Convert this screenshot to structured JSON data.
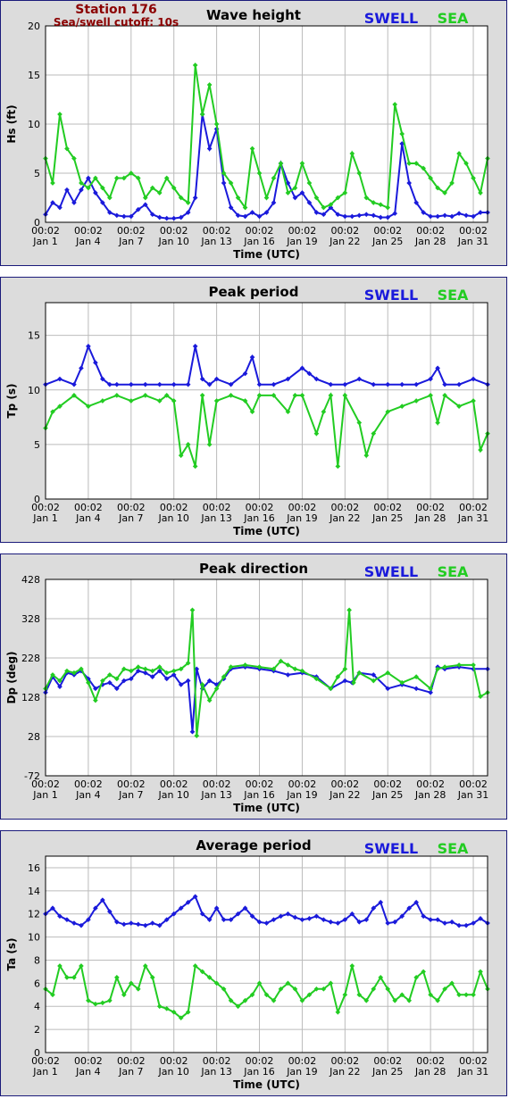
{
  "header": {
    "station": "Station 176",
    "cutoff": "Sea/swell cutoff: 10s"
  },
  "legend": {
    "swell": "SWELL",
    "sea": "SEA",
    "swell_color": "#1a1adb",
    "sea_color": "#22cc22"
  },
  "time_axis": {
    "title": "Time (UTC)",
    "ticks": [
      {
        "top": "00:02",
        "bottom": "Jan 1"
      },
      {
        "top": "00:02",
        "bottom": "Jan 4"
      },
      {
        "top": "00:02",
        "bottom": "Jan 7"
      },
      {
        "top": "00:02",
        "bottom": "Jan 10"
      },
      {
        "top": "00:02",
        "bottom": "Jan 13"
      },
      {
        "top": "00:02",
        "bottom": "Jan 16"
      },
      {
        "top": "00:02",
        "bottom": "Jan 19"
      },
      {
        "top": "00:02",
        "bottom": "Jan 22"
      },
      {
        "top": "00:02",
        "bottom": "Jan 25"
      },
      {
        "top": "00:02",
        "bottom": "Jan 28"
      },
      {
        "top": "00:02",
        "bottom": "Jan 31"
      }
    ]
  },
  "chart_data": [
    {
      "type": "line",
      "title": "Wave height",
      "ylabel": "Hs (ft)",
      "ylim": [
        0,
        20
      ],
      "yticks": [
        0,
        5,
        10,
        15,
        20
      ],
      "xlim": [
        1,
        32
      ],
      "series": [
        {
          "name": "SWELL",
          "color": "#1a1adb",
          "x": [
            1,
            1.5,
            2,
            2.5,
            3,
            3.5,
            4,
            4.5,
            5,
            5.5,
            6,
            6.5,
            7,
            7.5,
            8,
            8.5,
            9,
            9.5,
            10,
            10.5,
            11,
            11.5,
            12,
            12.5,
            13,
            13.5,
            14,
            14.5,
            15,
            15.5,
            16,
            16.5,
            17,
            17.5,
            18,
            18.5,
            19,
            19.5,
            20,
            20.5,
            21,
            21.5,
            22,
            22.5,
            23,
            23.5,
            24,
            24.5,
            25,
            25.5,
            26,
            26.5,
            27,
            27.5,
            28,
            28.5,
            29,
            29.5,
            30,
            30.5,
            31,
            31.5,
            32
          ],
          "y": [
            0.8,
            2.0,
            1.5,
            3.3,
            2.0,
            3.3,
            4.5,
            3.0,
            2.0,
            1.0,
            0.7,
            0.6,
            0.6,
            1.3,
            1.8,
            0.8,
            0.5,
            0.4,
            0.4,
            0.5,
            1.0,
            2.5,
            11.0,
            7.5,
            9.5,
            4.0,
            1.5,
            0.7,
            0.6,
            1.0,
            0.6,
            1.0,
            2.0,
            6.0,
            4.0,
            2.5,
            3.0,
            2.0,
            1.0,
            0.8,
            1.5,
            0.8,
            0.6,
            0.6,
            0.7,
            0.8,
            0.7,
            0.5,
            0.5,
            0.9,
            8.0,
            4.0,
            2.0,
            1.0,
            0.6,
            0.6,
            0.7,
            0.6,
            0.9,
            0.7,
            0.6,
            1.0,
            1.0
          ]
        },
        {
          "name": "SEA",
          "color": "#22cc22",
          "x": [
            1,
            1.5,
            2,
            2.5,
            3,
            3.5,
            4,
            4.5,
            5,
            5.5,
            6,
            6.5,
            7,
            7.5,
            8,
            8.5,
            9,
            9.5,
            10,
            10.5,
            11,
            11.5,
            12,
            12.5,
            13,
            13.5,
            14,
            14.5,
            15,
            15.5,
            16,
            16.5,
            17,
            17.5,
            18,
            18.5,
            19,
            19.5,
            20,
            20.5,
            21,
            21.5,
            22,
            22.5,
            23,
            23.5,
            24,
            24.5,
            25,
            25.5,
            26,
            26.5,
            27,
            27.5,
            28,
            28.5,
            29,
            29.5,
            30,
            30.5,
            31,
            31.5,
            32
          ],
          "y": [
            6.5,
            4.0,
            11.0,
            7.5,
            6.5,
            4.0,
            3.5,
            4.5,
            3.5,
            2.5,
            4.5,
            4.5,
            5.0,
            4.5,
            2.5,
            3.5,
            3.0,
            4.5,
            3.5,
            2.5,
            2.0,
            16.0,
            11.0,
            14.0,
            10.0,
            5.0,
            4.0,
            2.5,
            1.5,
            7.5,
            5.0,
            2.5,
            4.5,
            6.0,
            3.0,
            3.5,
            6.0,
            4.0,
            2.5,
            1.5,
            1.8,
            2.5,
            3.0,
            7.0,
            5.0,
            2.5,
            2.0,
            1.8,
            1.5,
            12.0,
            9.0,
            6.0,
            6.0,
            5.5,
            4.5,
            3.5,
            3.0,
            4.0,
            7.0,
            6.0,
            4.5,
            3.0,
            6.5
          ]
        }
      ]
    },
    {
      "type": "line",
      "title": "Peak period",
      "ylabel": "Tp (s)",
      "ylim": [
        0,
        18
      ],
      "yticks": [
        0,
        5,
        10,
        15
      ],
      "xlim": [
        1,
        32
      ],
      "series": [
        {
          "name": "SWELL",
          "color": "#1a1adb",
          "x": [
            1,
            2,
            3,
            3.5,
            4,
            4.5,
            5,
            5.5,
            6,
            7,
            8,
            9,
            10,
            11,
            11.5,
            12,
            12.5,
            13,
            14,
            15,
            15.5,
            16,
            17,
            18,
            19,
            19.5,
            20,
            21,
            22,
            23,
            24,
            25,
            26,
            27,
            28,
            28.5,
            29,
            30,
            31,
            32
          ],
          "y": [
            10.5,
            11,
            10.5,
            12,
            14,
            12.5,
            11,
            10.5,
            10.5,
            10.5,
            10.5,
            10.5,
            10.5,
            10.5,
            14,
            11,
            10.5,
            11,
            10.5,
            11.5,
            13,
            10.5,
            10.5,
            11,
            12,
            11.5,
            11,
            10.5,
            10.5,
            11,
            10.5,
            10.5,
            10.5,
            10.5,
            11,
            12,
            10.5,
            10.5,
            11,
            10.5
          ]
        },
        {
          "name": "SEA",
          "color": "#22cc22",
          "x": [
            1,
            1.5,
            2,
            3,
            4,
            5,
            6,
            7,
            8,
            9,
            9.5,
            10,
            10.5,
            11,
            11.5,
            12,
            12.5,
            13,
            14,
            15,
            15.5,
            16,
            17,
            18,
            18.5,
            19,
            20,
            20.5,
            21,
            21.5,
            22,
            23,
            23.5,
            24,
            25,
            26,
            27,
            28,
            28.5,
            29,
            30,
            31,
            31.5,
            32
          ],
          "y": [
            6.5,
            8,
            8.5,
            9.5,
            8.5,
            9,
            9.5,
            9,
            9.5,
            9,
            9.5,
            9,
            4,
            5,
            3,
            9.5,
            5,
            9,
            9.5,
            9,
            8,
            9.5,
            9.5,
            8,
            9.5,
            9.5,
            6,
            8,
            9.5,
            3,
            9.5,
            7,
            4,
            6,
            8,
            8.5,
            9,
            9.5,
            7,
            9.5,
            8.5,
            9,
            4.5,
            6
          ]
        }
      ]
    },
    {
      "type": "line",
      "title": "Peak direction",
      "ylabel": "Dp (deg)",
      "ylim": [
        -72,
        428
      ],
      "yticks": [
        -72,
        28,
        128,
        228,
        328,
        428
      ],
      "xlim": [
        1,
        32
      ],
      "series": [
        {
          "name": "SWELL",
          "color": "#1a1adb",
          "x": [
            1,
            1.5,
            2,
            2.5,
            3,
            3.5,
            4,
            4.5,
            5,
            5.5,
            6,
            6.5,
            7,
            7.5,
            8,
            8.5,
            9,
            9.5,
            10,
            10.5,
            11,
            11.3,
            11.6,
            12,
            12.5,
            13,
            13.5,
            14,
            15,
            16,
            17,
            18,
            19,
            20,
            21,
            22,
            22.5,
            23,
            24,
            25,
            26,
            27,
            28,
            28.5,
            29,
            30,
            31,
            32
          ],
          "y": [
            140,
            180,
            155,
            190,
            185,
            195,
            175,
            150,
            160,
            165,
            150,
            170,
            175,
            195,
            190,
            180,
            195,
            175,
            185,
            160,
            170,
            40,
            200,
            150,
            170,
            160,
            175,
            200,
            205,
            200,
            195,
            185,
            190,
            180,
            150,
            170,
            165,
            190,
            185,
            150,
            160,
            150,
            140,
            205,
            200,
            205,
            200,
            200
          ]
        },
        {
          "name": "SEA",
          "color": "#22cc22",
          "x": [
            1,
            1.5,
            2,
            2.5,
            3,
            3.5,
            4,
            4.5,
            5,
            5.5,
            6,
            6.5,
            7,
            7.5,
            8,
            8.5,
            9,
            9.5,
            10,
            10.5,
            11,
            11.3,
            11.6,
            12,
            12.5,
            13,
            13.5,
            14,
            15,
            16,
            17,
            17.5,
            18,
            18.5,
            19,
            20,
            21,
            21.5,
            22,
            22.3,
            22.6,
            23,
            24,
            25,
            26,
            27,
            28,
            28.5,
            29,
            30,
            31,
            31.5,
            32
          ],
          "y": [
            150,
            185,
            170,
            195,
            190,
            200,
            165,
            120,
            170,
            185,
            175,
            200,
            195,
            205,
            200,
            195,
            205,
            190,
            195,
            200,
            215,
            350,
            30,
            160,
            120,
            150,
            180,
            205,
            210,
            205,
            200,
            220,
            210,
            200,
            195,
            175,
            150,
            180,
            200,
            350,
            165,
            190,
            170,
            190,
            165,
            180,
            150,
            200,
            205,
            210,
            210,
            130,
            140
          ]
        }
      ]
    },
    {
      "type": "line",
      "title": "Average period",
      "ylabel": "Ta (s)",
      "ylim": [
        0,
        17
      ],
      "yticks": [
        0,
        2,
        4,
        6,
        8,
        10,
        12,
        14,
        16
      ],
      "xlim": [
        1,
        32
      ],
      "series": [
        {
          "name": "SWELL",
          "color": "#1a1adb",
          "x": [
            1,
            1.5,
            2,
            2.5,
            3,
            3.5,
            4,
            4.5,
            5,
            5.5,
            6,
            6.5,
            7,
            7.5,
            8,
            8.5,
            9,
            9.5,
            10,
            10.5,
            11,
            11.5,
            12,
            12.5,
            13,
            13.5,
            14,
            14.5,
            15,
            15.5,
            16,
            16.5,
            17,
            17.5,
            18,
            18.5,
            19,
            19.5,
            20,
            20.5,
            21,
            21.5,
            22,
            22.5,
            23,
            23.5,
            24,
            24.5,
            25,
            25.5,
            26,
            26.5,
            27,
            27.5,
            28,
            28.5,
            29,
            29.5,
            30,
            30.5,
            31,
            31.5,
            32
          ],
          "y": [
            12,
            12.5,
            11.8,
            11.5,
            11.2,
            11.0,
            11.5,
            12.5,
            13.2,
            12.2,
            11.3,
            11.1,
            11.2,
            11.1,
            11.0,
            11.2,
            11.0,
            11.5,
            12,
            12.5,
            13,
            13.5,
            12,
            11.5,
            12.5,
            11.5,
            11.5,
            12,
            12.5,
            11.8,
            11.3,
            11.2,
            11.5,
            11.8,
            12,
            11.7,
            11.5,
            11.6,
            11.8,
            11.5,
            11.3,
            11.2,
            11.5,
            12,
            11.3,
            11.5,
            12.5,
            13,
            11.2,
            11.3,
            11.8,
            12.5,
            13,
            11.8,
            11.5,
            11.5,
            11.2,
            11.3,
            11.0,
            11.0,
            11.2,
            11.6,
            11.2
          ]
        },
        {
          "name": "SEA",
          "color": "#22cc22",
          "x": [
            1,
            1.5,
            2,
            2.5,
            3,
            3.5,
            4,
            4.5,
            5,
            5.5,
            6,
            6.5,
            7,
            7.5,
            8,
            8.5,
            9,
            9.5,
            10,
            10.5,
            11,
            11.5,
            12,
            12.5,
            13,
            13.5,
            14,
            14.5,
            15,
            15.5,
            16,
            16.5,
            17,
            17.5,
            18,
            18.5,
            19,
            19.5,
            20,
            20.5,
            21,
            21.5,
            22,
            22.5,
            23,
            23.5,
            24,
            24.5,
            25,
            25.5,
            26,
            26.5,
            27,
            27.5,
            28,
            28.5,
            29,
            29.5,
            30,
            30.5,
            31,
            31.5,
            32
          ],
          "y": [
            5.5,
            5,
            7.5,
            6.5,
            6.5,
            7.5,
            4.5,
            4.2,
            4.3,
            4.5,
            6.5,
            5,
            6,
            5.5,
            7.5,
            6.5,
            4,
            3.8,
            3.5,
            3,
            3.5,
            7.5,
            7,
            6.5,
            6,
            5.5,
            4.5,
            4,
            4.5,
            5,
            6,
            5,
            4.5,
            5.5,
            6,
            5.5,
            4.5,
            5,
            5.5,
            5.5,
            6,
            3.5,
            5,
            7.5,
            5,
            4.5,
            5.5,
            6.5,
            5.5,
            4.5,
            5,
            4.5,
            6.5,
            7,
            5,
            4.5,
            5.5,
            6,
            5,
            5,
            5,
            7,
            5.5
          ]
        }
      ]
    }
  ]
}
